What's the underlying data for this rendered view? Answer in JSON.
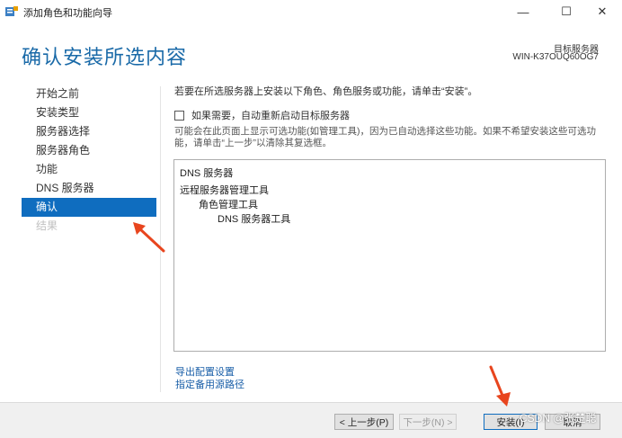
{
  "window": {
    "title": "添加角色和功能向导",
    "minimize_glyph": "—",
    "maximize_glyph": "☐",
    "close_glyph": "✕"
  },
  "header": {
    "title": "确认安装所选内容",
    "target_label": "目标服务器",
    "target_name": "WIN-K37OUQ60OG7"
  },
  "sidebar": {
    "items": [
      {
        "label": "开始之前",
        "state": "normal"
      },
      {
        "label": "安装类型",
        "state": "normal"
      },
      {
        "label": "服务器选择",
        "state": "normal"
      },
      {
        "label": "服务器角色",
        "state": "normal"
      },
      {
        "label": "功能",
        "state": "normal"
      },
      {
        "label": "DNS 服务器",
        "state": "normal"
      },
      {
        "label": "确认",
        "state": "active"
      },
      {
        "label": "结果",
        "state": "disabled"
      }
    ]
  },
  "main": {
    "intro": "若要在所选服务器上安装以下角色、角色服务或功能，请单击“安装”。",
    "restart_checkbox_label": "如果需要，自动重新启动目标服务器",
    "restart_checked": false,
    "note_line1": "可能会在此页面上显示可选功能(如管理工具)，因为已自动选择这些功能。如果不希望安装这些可选功",
    "note_line2": "能，请单击“上一步”以清除其复选框。",
    "selection_list": [
      {
        "text": "DNS 服务器",
        "level": 0
      },
      {
        "text": "远程服务器管理工具",
        "level": 0
      },
      {
        "text": "角色管理工具",
        "level": 1
      },
      {
        "text": "DNS 服务器工具",
        "level": 2
      }
    ],
    "export_link": "导出配置设置",
    "alt_source_link": "指定备用源路径"
  },
  "footer": {
    "prev_label": "< 上一步(P)",
    "next_label": "下一步(N) >",
    "install_label": "安装(I)",
    "cancel_label": "取消"
  },
  "watermark": "CSDN @张楚聪",
  "colors": {
    "accent": "#0f6dbf",
    "title_blue": "#1a6aa8",
    "annotation_arrow": "#e8451e"
  }
}
